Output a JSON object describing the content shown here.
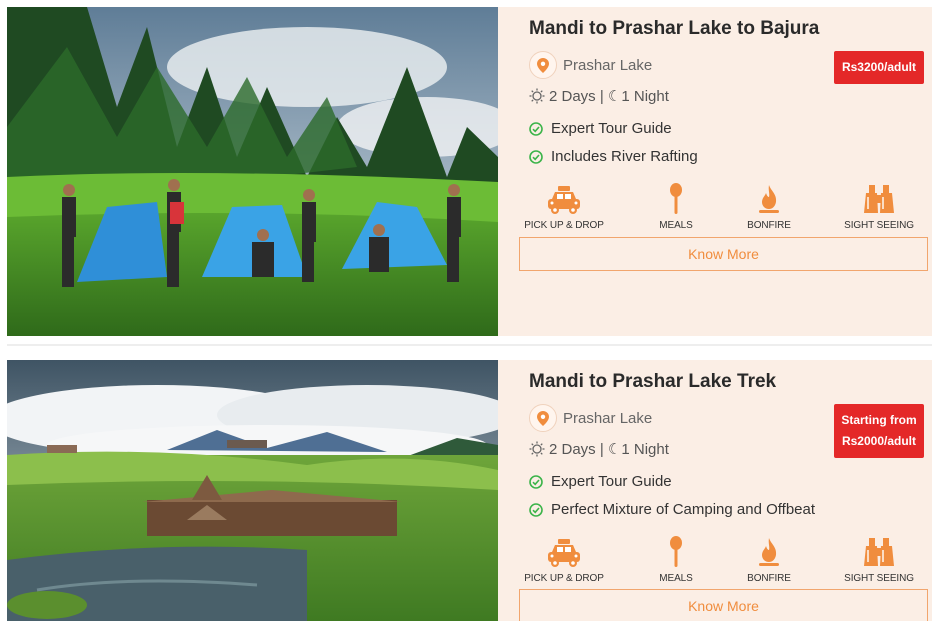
{
  "packages": [
    {
      "title": "Mandi to Prashar Lake to Bajura",
      "location": "Prashar Lake",
      "duration": "2 Days | ☾1 Night",
      "features": [
        "Expert Tour Guide",
        "Includes River Rafting"
      ],
      "price_lines": [
        "Rs3200/adult"
      ],
      "amenities": [
        "PICK UP & DROP",
        "MEALS",
        "BONFIRE",
        "SIGHT SEEING"
      ],
      "cta": "Know More"
    },
    {
      "title": "Mandi to Prashar Lake Trek",
      "location": "Prashar Lake",
      "duration": "2 Days | ☾1 Night",
      "features": [
        "Expert Tour Guide",
        "Perfect Mixture of Camping and Offbeat"
      ],
      "price_lines": [
        "Starting from",
        "Rs2000/adult"
      ],
      "amenities": [
        "PICK UP & DROP",
        "MEALS",
        "BONFIRE",
        "SIGHT SEEING"
      ],
      "cta": "Know More"
    }
  ],
  "colors": {
    "card_bg": "#fbeee5",
    "accent_orange": "#f08d3e",
    "price_red": "#e42828",
    "check_green": "#3cb44a"
  },
  "icons": {
    "location": "map-pin-icon",
    "duration": "sun-icon",
    "feature": "check-circle-icon",
    "amenities": [
      "taxi-icon",
      "spoon-icon",
      "fire-icon",
      "binoculars-icon"
    ]
  }
}
